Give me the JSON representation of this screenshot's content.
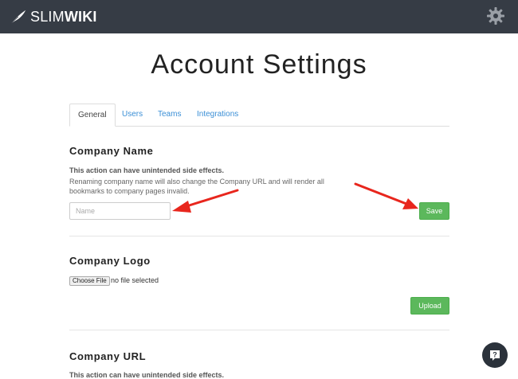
{
  "header": {
    "logo_light": "SLIM",
    "logo_bold": "WIKI"
  },
  "page": {
    "title": "Account Settings"
  },
  "tabs": [
    {
      "label": "General",
      "active": true
    },
    {
      "label": "Users",
      "active": false
    },
    {
      "label": "Teams",
      "active": false
    },
    {
      "label": "Integrations",
      "active": false
    }
  ],
  "company_name": {
    "title": "Company Name",
    "warning": "This action can have unintended side effects.",
    "description": "Renaming company name will also change the Company URL and will render all bookmarks to company pages invalid.",
    "input_value": "",
    "input_placeholder": "Name",
    "save_label": "Save"
  },
  "company_logo": {
    "title": "Company Logo",
    "choose_file_label": "Choose File",
    "file_status": "no file selected",
    "upload_label": "Upload"
  },
  "company_url": {
    "title": "Company URL",
    "warning": "This action can have unintended side effects."
  },
  "colors": {
    "header_bg": "#363c45",
    "accent_green": "#5cb85c",
    "link_blue": "#3b8fd6",
    "annotation_red": "#e8261d"
  },
  "icons": {
    "logo": "feather-icon",
    "settings": "gear-icon",
    "help": "question-mark-icon"
  }
}
